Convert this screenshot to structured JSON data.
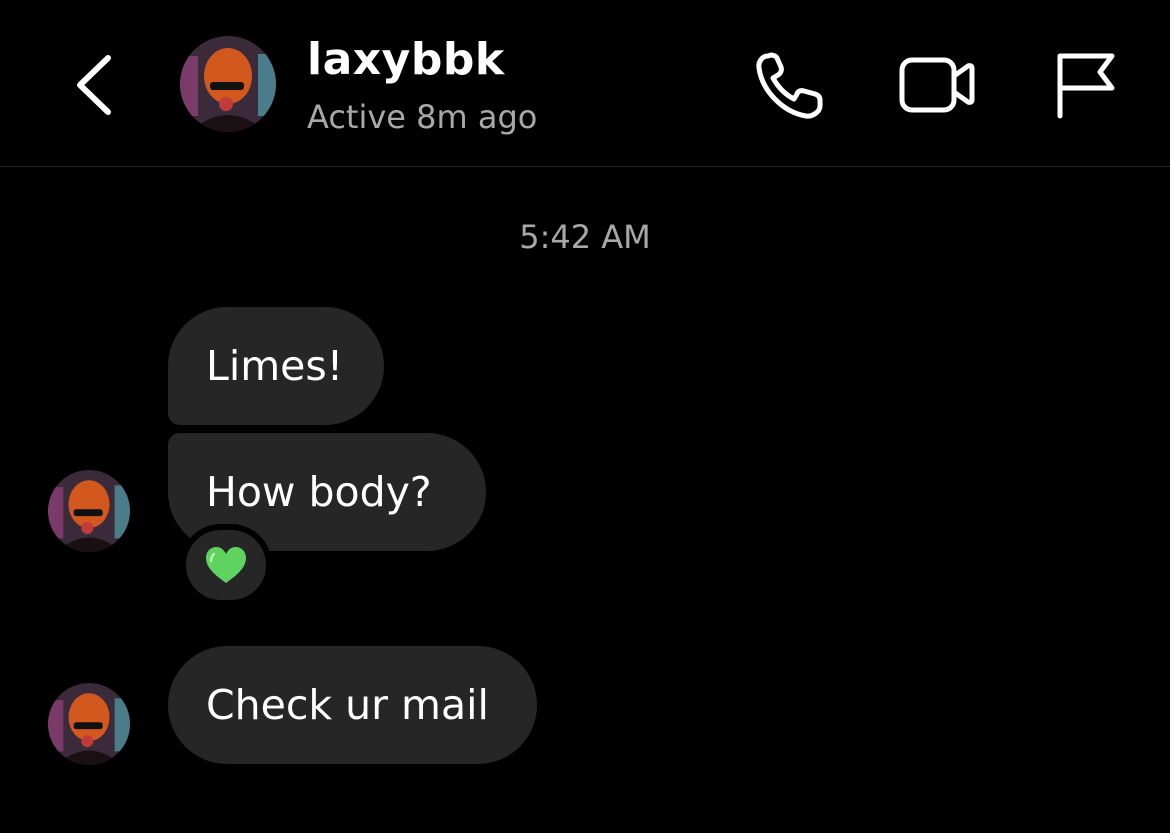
{
  "header": {
    "username": "laxybbk",
    "status": "Active 8m ago",
    "icons": {
      "back": "chevron-left-icon",
      "call": "phone-icon",
      "video": "video-camera-icon",
      "report": "flag-icon"
    }
  },
  "thread": {
    "timestamp": "5:42 AM",
    "messages": [
      {
        "text": "Limes!"
      },
      {
        "text": "How body?",
        "reaction": "green-heart"
      },
      {
        "text": "Check ur mail"
      }
    ]
  },
  "colors": {
    "background": "#000000",
    "bubble": "#262626",
    "secondary_text": "#a8a8a8",
    "reaction_heart": "#5fd35f"
  }
}
